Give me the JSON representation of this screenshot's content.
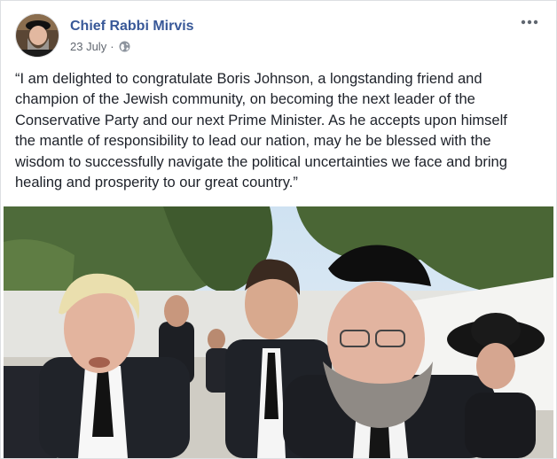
{
  "post": {
    "author": "Chief Rabbi Mirvis",
    "date": "23 July",
    "separator": "·",
    "privacy_icon": "globe-icon",
    "options_icon": "more-options-icon",
    "lines": [
      "“I am delighted to congratulate Boris Johnson, a longstanding friend and",
      "champion of the Jewish community, on becoming the next leader of the",
      "Conservative Party and our next Prime Minister. As he accepts upon himself",
      "the mantle of responsibility to lead our nation, may he be blessed with the",
      "wisdom to successfully navigate the political uncertainties we face and bring",
      "healing and prosperity to our great country.”"
    ]
  },
  "colors": {
    "author_link": "#385898",
    "meta_text": "#616770",
    "body_text": "#1d2129",
    "card_border": "#dddfe2"
  }
}
